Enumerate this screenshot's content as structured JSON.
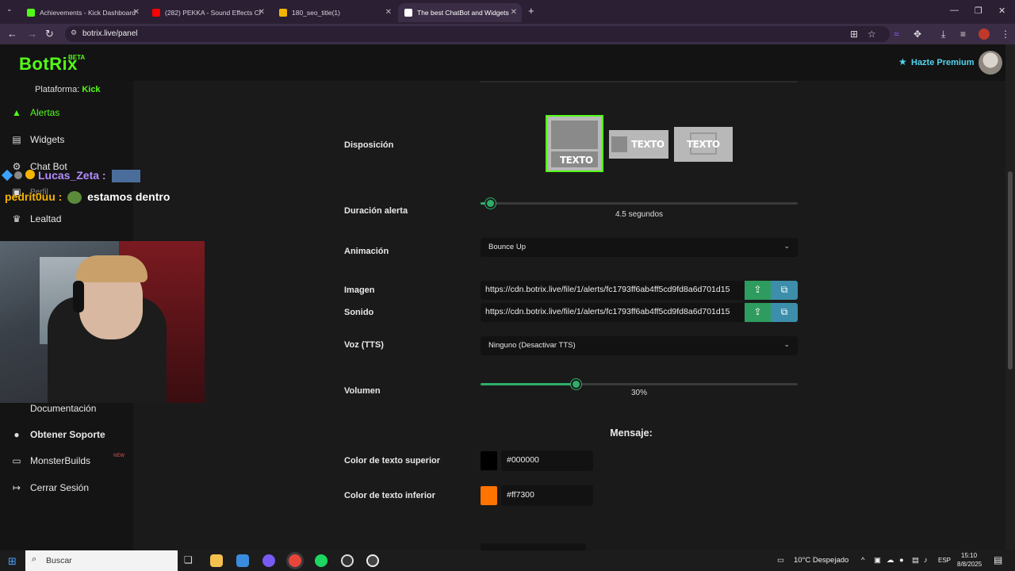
{
  "browser": {
    "tabs": [
      {
        "title": "Achievements - Kick Dashboard",
        "favicon_color": "#53fc18",
        "active": false
      },
      {
        "title": "(282) PEKKA - Sound Effects Cl",
        "favicon_color": "#ff0000",
        "active": false
      },
      {
        "title": "180_seo_title(1)",
        "favicon_color": "#f5b400",
        "active": false
      },
      {
        "title": "The best ChatBot and Widgets",
        "favicon_color": "#ffffff",
        "active": true
      }
    ],
    "new_tab": "+",
    "url": "botrix.live/panel",
    "controls": {
      "minimize": "—",
      "restore": "❐",
      "close": "✕"
    }
  },
  "header": {
    "logo": "BotRix",
    "logo_badge": "BETA",
    "premium_label": "Hazte Premium",
    "premium_icon": "star-icon"
  },
  "sidebar": {
    "platform_label": "Plataforma:",
    "platform_value": "Kick",
    "items": [
      {
        "label": "Alertas",
        "icon": "alert-triangle-icon",
        "active": true
      },
      {
        "label": "Widgets",
        "icon": "widgets-icon"
      },
      {
        "label": "Chat Bot",
        "icon": "robot-icon"
      },
      {
        "label": "Perfil",
        "icon": "profile-icon"
      },
      {
        "label": "Lealtad",
        "icon": "trophy-icon"
      },
      {
        "label": "Documentación",
        "icon": "book-icon"
      },
      {
        "label": "Obtener Soporte",
        "icon": "support-icon"
      },
      {
        "label": "MonsterBuilds",
        "icon": "laptop-icon"
      },
      {
        "label": "Cerrar Sesión",
        "icon": "logout-icon"
      }
    ],
    "new_badge": "NEW"
  },
  "form": {
    "disposicion": {
      "label": "Disposición",
      "options": [
        "TEXTO",
        "TEXTO",
        "TEXTO"
      ],
      "selected": 0
    },
    "duracion": {
      "label": "Duración alerta",
      "value_text": "4.5 segundos",
      "fraction": 0.03
    },
    "animacion": {
      "label": "Animación",
      "value": "Bounce Up"
    },
    "imagen": {
      "label": "Imagen",
      "value": "https://cdn.botrix.live/file/1/alerts/fc1793ff6ab4ff5cd9fd8a6d701d15"
    },
    "sonido": {
      "label": "Sonido",
      "value": "https://cdn.botrix.live/file/1/alerts/fc1793ff6ab4ff5cd9fd8a6d701d15"
    },
    "voz": {
      "label": "Voz (TTS)",
      "value": "Ninguno (Desactivar TTS)"
    },
    "volumen": {
      "label": "Volumen",
      "value_text": "30%",
      "fraction": 0.3
    },
    "mensaje_heading": "Mensaje:",
    "color_superior": {
      "label": "Color de texto superior",
      "value": "#000000",
      "swatch": "#000000"
    },
    "color_inferior": {
      "label": "Color de texto inferior",
      "value": "#ff7300",
      "swatch": "#ff7300"
    }
  },
  "stream_overlay": {
    "chat": [
      {
        "user": "Lucas_Zeta :",
        "user_color": "#b48cff",
        "message": ""
      },
      {
        "user": "pedrit0uu :",
        "user_color": "#f5b400",
        "message": "estamos dentro"
      }
    ]
  },
  "taskbar": {
    "search_placeholder": "Buscar",
    "weather": "10°C  Despejado",
    "language": "ESP",
    "time": "15:10",
    "date": "8/8/2025"
  }
}
